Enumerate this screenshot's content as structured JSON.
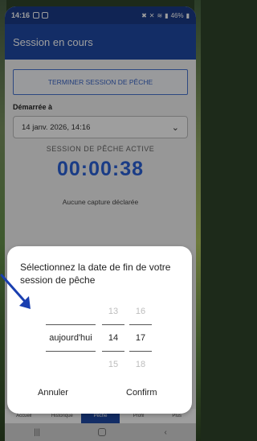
{
  "status_bar": {
    "time": "14:16",
    "battery": "46%"
  },
  "app_bar": {
    "title": "Session en cours"
  },
  "main": {
    "end_button": "TERMINER SESSION DE PÊCHE",
    "started_label": "Démarrée à",
    "started_value": "14 janv. 2026, 14:16",
    "active_label": "SESSION DE PÊCHE ACTIVE",
    "timer": "00:00:38",
    "no_catch": "Aucune capture déclarée"
  },
  "dialog": {
    "title": "Sélectionnez la date de fin de votre session de pêche",
    "day_selected": "aujourd'hui",
    "hours": [
      "13",
      "14",
      "15"
    ],
    "minutes": [
      "16",
      "17",
      "18"
    ],
    "cancel": "Annuler",
    "confirm": "Confirm"
  },
  "bottom_nav": [
    "Accueil",
    "Historique",
    "Pêche",
    "Profil",
    "Plus"
  ],
  "colors": {
    "primary": "#1f4aa5",
    "timer": "#2a62d8",
    "status_bar": "#1b3b88"
  }
}
